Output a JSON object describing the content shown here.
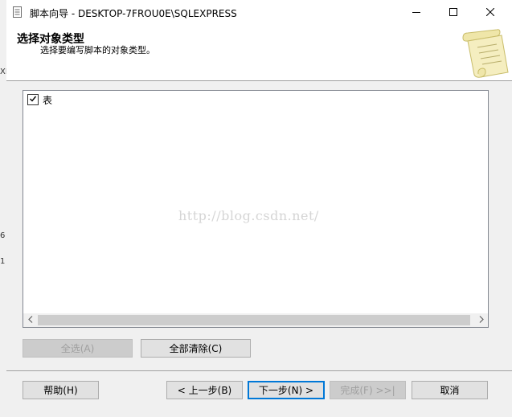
{
  "window": {
    "title": "脚本向导 - DESKTOP-7FROU0E\\SQLEXPRESS",
    "icon": "script-document-icon"
  },
  "header": {
    "heading": "选择对象类型",
    "subheading": "选择要编写脚本的对象类型。",
    "art_icon": "scroll-parchment-icon"
  },
  "object_types": {
    "items": [
      {
        "label": "表",
        "checked": true
      }
    ]
  },
  "watermark": "http://blog.csdn.net/",
  "buttons": {
    "select_all": "全选(A)",
    "clear_all": "全部清除(C)",
    "help": "帮助(H)",
    "previous": "< 上一步(B)",
    "next": "下一步(N) >",
    "finish": "完成(F) >>|",
    "cancel": "取消"
  },
  "background_fragments": [
    "XI",
    "6",
    "1"
  ],
  "colors": {
    "accent": "#0078d7",
    "dialog_bg": "#f0f0f0",
    "header_bg": "#ffffff"
  }
}
